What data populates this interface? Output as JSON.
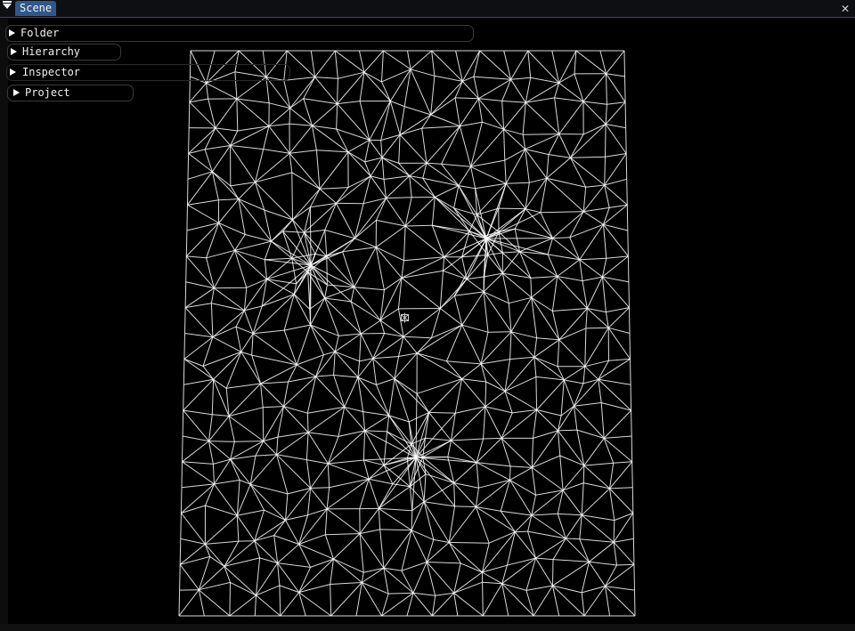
{
  "window": {
    "tab_label": "Scene",
    "close_glyph": "✕"
  },
  "panels": {
    "folder": "Folder",
    "hierarchy": "Hierarchy",
    "inspector": "Inspector",
    "project": "Project"
  },
  "colors": {
    "accent": "#2f5789",
    "mesh_line": "#ffffff",
    "viewport_bg": "#000000"
  },
  "icons": {
    "collapse": "collapse-triangle-icon",
    "expand": "expand-triangle-icon",
    "close": "close-icon",
    "gizmo": "camera-gizmo-icon"
  }
}
